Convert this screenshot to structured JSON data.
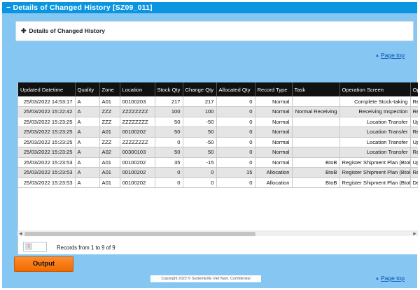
{
  "window": {
    "title": "Details of Changed History [SZ09_011]",
    "collapse_icon": "minus-icon"
  },
  "panel": {
    "label": "Details of Changed History",
    "expand_icon": "plus-icon"
  },
  "links": {
    "page_top": "Page top"
  },
  "grid": {
    "columns": [
      "Updated Datetime",
      "Quality",
      "Zone",
      "Location",
      "Stock Qty",
      "Change Qty",
      "Allocated Qty",
      "Record Type",
      "Task",
      "Operation Screen",
      "Op"
    ],
    "rows": [
      [
        "25/03/2022 14:53:17",
        "A",
        "A01",
        "00100203",
        "217",
        "217",
        "0",
        "Normal",
        "",
        "Complete Stock-taking",
        "Re"
      ],
      [
        "25/03/2022 15:22:42",
        "A",
        "ZZZ",
        "ZZZZZZZZ",
        "100",
        "100",
        "0",
        "Normal",
        "Normal Receiving",
        "Receiving Inspection",
        "Re"
      ],
      [
        "25/03/2022 15:23:25",
        "A",
        "ZZZ",
        "ZZZZZZZZ",
        "50",
        "-50",
        "0",
        "Normal",
        "",
        "Location Transfer",
        "Up"
      ],
      [
        "25/03/2022 15:23:25",
        "A",
        "A01",
        "00100202",
        "50",
        "50",
        "0",
        "Normal",
        "",
        "Location Transfer",
        "Re"
      ],
      [
        "25/03/2022 15:23:25",
        "A",
        "ZZZ",
        "ZZZZZZZZ",
        "0",
        "-50",
        "0",
        "Normal",
        "",
        "Location Transfer",
        "Up"
      ],
      [
        "25/03/2022 15:23:25",
        "A",
        "A02",
        "00300103",
        "50",
        "50",
        "0",
        "Normal",
        "",
        "Location Transfer",
        "Re"
      ],
      [
        "25/03/2022 15:23:53",
        "A",
        "A01",
        "00100202",
        "35",
        "-15",
        "0",
        "Normal",
        "BtoB",
        "Register Shipment Plan (BtoB",
        "Up"
      ],
      [
        "25/03/2022 15:23:53",
        "A",
        "A01",
        "00100202",
        "0",
        "0",
        "15",
        "Allocation",
        "BtoB",
        "Register Shipment Plan (BtoB",
        "Re"
      ],
      [
        "25/03/2022 15:23:53",
        "A",
        "A01",
        "00100202",
        "0",
        "0",
        "0",
        "Allocation",
        "BtoB",
        "Register Shipment Plan (BtoB",
        "De"
      ]
    ]
  },
  "pager": {
    "current_page": "1",
    "records_text": "Records from 1 to 9 of 9"
  },
  "buttons": {
    "output": "Output"
  },
  "footer": {
    "copyright": "Copyright 2022 © SystemEXE Viet Nam. Confidential"
  },
  "colors": {
    "title_bar": "#0a95e0",
    "background": "#85c6f2",
    "header": "#111111",
    "output_button": "#f47a10"
  }
}
